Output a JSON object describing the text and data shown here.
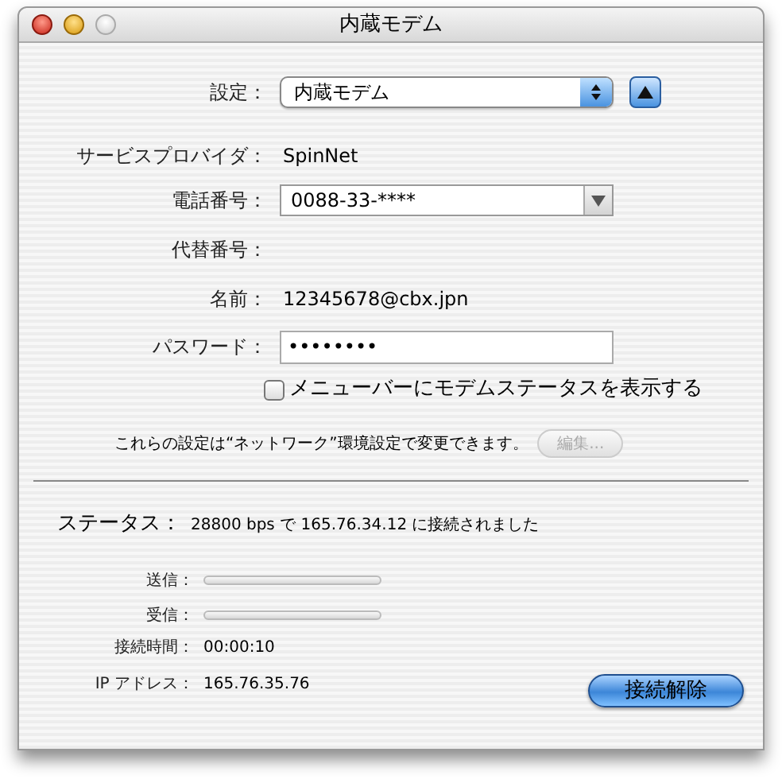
{
  "window": {
    "title": "内蔵モデム"
  },
  "settings": {
    "label": "設定：",
    "value": "内蔵モデム"
  },
  "provider": {
    "label": "サービスプロバイダ：",
    "value": "SpinNet"
  },
  "phone": {
    "label": "電話番号：",
    "value": "0088-33-****"
  },
  "alt_number": {
    "label": "代替番号："
  },
  "name": {
    "label": "名前：",
    "value": "12345678@cbx.jpn"
  },
  "password": {
    "label": "パスワード：",
    "value": "••••••••"
  },
  "menu_checkbox": {
    "label": "メニューバーにモデムステータスを表示する",
    "checked": false
  },
  "note": "これらの設定は“ネットワーク”環境設定で変更できます。",
  "edit_button": {
    "label": "編集...",
    "disabled": true
  },
  "status": {
    "label": "ステータス：",
    "value": "28800 bps で 165.76.34.12 に接続されました"
  },
  "meters": [
    {
      "label": "送信：",
      "level": 0
    },
    {
      "label": "受信：",
      "level": 0
    }
  ],
  "info": [
    {
      "label": "接続時間：",
      "value": "00:00:10"
    },
    {
      "label": "IP アドレス：",
      "value": "165.76.35.76"
    }
  ],
  "disconnect_button": "接続解除"
}
